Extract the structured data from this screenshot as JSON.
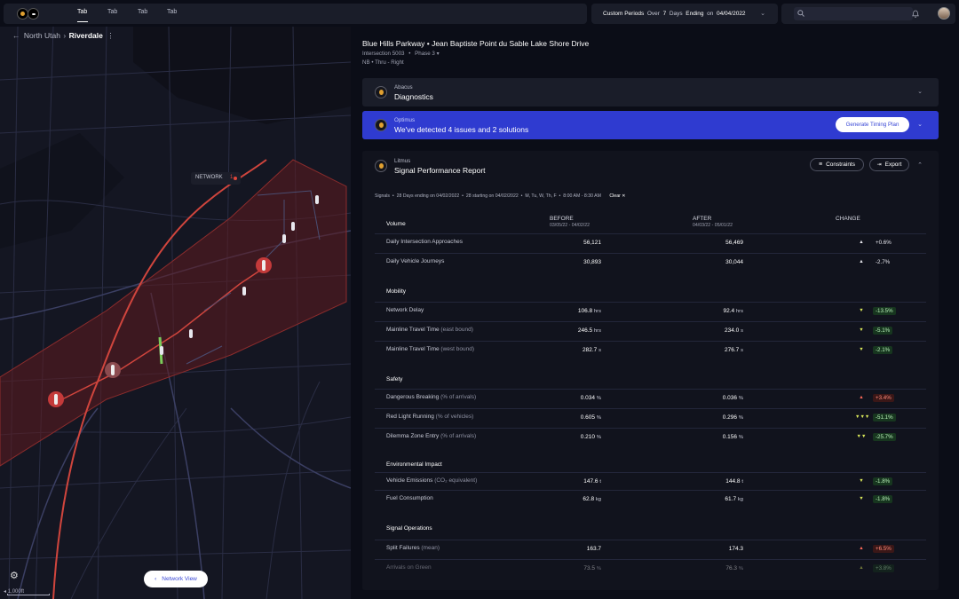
{
  "topbar": {
    "tabs": [
      "Tab",
      "Tab",
      "Tab",
      "Tab"
    ],
    "period_label": "Custom Periods",
    "over_word": "Over",
    "days_count": "7",
    "days_word": "Days",
    "ending_word": "Ending",
    "on_word": "on",
    "ending_date": "04/04/2022"
  },
  "breadcrumb": {
    "parent": "North Utah",
    "current": "Riverdale"
  },
  "map": {
    "network_label": "NETWORK",
    "network_count": "1",
    "network_view_label": "Network View",
    "scale_label": "1,000ft"
  },
  "header": {
    "title": "Blue Hills Parkway  •  Jean Baptiste Point du Sable Lake Shore Drive",
    "intersection": "Intersection 5003",
    "phase": "Phase 3",
    "direction": "NB • Thru - Right"
  },
  "cards": {
    "abacus": {
      "small": "Abacus",
      "big": "Diagnostics"
    },
    "optimus": {
      "small": "Optimus",
      "big": "We've detected 4 issues and 2 solutions",
      "button": "Generate Timing Plan"
    },
    "litmus": {
      "small": "Litmus",
      "big": "Signal Performance Report",
      "constraints": "Constraints",
      "export": "Export"
    }
  },
  "filters": {
    "items": [
      "Signals",
      "28 Days ending on 04/02/2022",
      "28 starting on 04/02/2022",
      "M, Tu, W, Th, F",
      "8:00 AM - 8:30 AM"
    ],
    "clear": "Clear"
  },
  "columns": {
    "before": "BEFORE",
    "before_range": "03/05/22 - 04/02/22",
    "after": "AFTER",
    "after_range": "04/03/22 - 05/01/22",
    "change": "CHANGE"
  },
  "sections": [
    {
      "name": "Volume",
      "rows": [
        {
          "label": "Daily Intersection Approaches",
          "paren": "",
          "before": "56,121",
          "before_unit": "",
          "after": "56,469",
          "after_unit": "",
          "trend": "▲",
          "change": "+0.6%",
          "style": "neutral"
        },
        {
          "label": "Daily Vehicle Journeys",
          "paren": "",
          "before": "30,893",
          "before_unit": "",
          "after": "30,044",
          "after_unit": "",
          "trend": "▲",
          "change": "-2.7%",
          "style": "neutral"
        }
      ]
    },
    {
      "name": "Mobility",
      "rows": [
        {
          "label": "Network Delay",
          "paren": "",
          "before": "106.8",
          "before_unit": "hrs",
          "after": "92.4",
          "after_unit": "hrs",
          "trend": "▼",
          "change": "-13.5%",
          "style": "green"
        },
        {
          "label": "Mainline Travel Time",
          "paren": "(east bound)",
          "before": "246.5",
          "before_unit": "hrs",
          "after": "234.0",
          "after_unit": "s",
          "trend": "▼",
          "change": "-5.1%",
          "style": "green"
        },
        {
          "label": "Mainline Travel Time",
          "paren": "(west bound)",
          "before": "282.7",
          "before_unit": "s",
          "after": "276.7",
          "after_unit": "s",
          "trend": "▼",
          "change": "-2.1%",
          "style": "green"
        }
      ]
    },
    {
      "name": "Safety",
      "rows": [
        {
          "label": "Dangerous Breaking",
          "paren": "(% of arrivals)",
          "before": "0.034",
          "before_unit": "%",
          "after": "0.036",
          "after_unit": "%",
          "trend": "▲",
          "change": "+3.4%",
          "style": "red"
        },
        {
          "label": "Red Light Running",
          "paren": "(% of vehicles)",
          "before": "0.605",
          "before_unit": "%",
          "after": "0.296",
          "after_unit": "%",
          "trend": "▼▼▼",
          "change": "-51.1%",
          "style": "green"
        },
        {
          "label": "Dilemma Zone Entry",
          "paren": "(% of arrivals)",
          "before": "0.210",
          "before_unit": "%",
          "after": "0.156",
          "after_unit": "%",
          "trend": "▼▼",
          "change": "-25.7%",
          "style": "green"
        }
      ]
    },
    {
      "name": "Environmental Impact",
      "rows": [
        {
          "label": "Vehicle Emissions",
          "paren": "(CO₂ equivalent)",
          "before": "147.6",
          "before_unit": "t",
          "after": "144.8",
          "after_unit": "t",
          "trend": "▼",
          "change": "-1.8%",
          "style": "green"
        },
        {
          "label": "Fuel Consumption",
          "paren": "",
          "before": "62.8",
          "before_unit": "kg",
          "after": "61.7",
          "after_unit": "kg",
          "trend": "▼",
          "change": "-1.8%",
          "style": "green"
        }
      ]
    },
    {
      "name": "Signal Operations",
      "rows": [
        {
          "label": "Split Failures",
          "paren": "(mean)",
          "before": "163.7",
          "before_unit": "",
          "after": "174.3",
          "after_unit": "",
          "trend": "▲",
          "change": "+6.5%",
          "style": "red"
        },
        {
          "label": "Arrivals on Green",
          "paren": "",
          "before": "73.5",
          "before_unit": "%",
          "after": "76.3",
          "after_unit": "%",
          "trend": "▲",
          "change": "+3.8%",
          "style": "green"
        }
      ]
    }
  ]
}
